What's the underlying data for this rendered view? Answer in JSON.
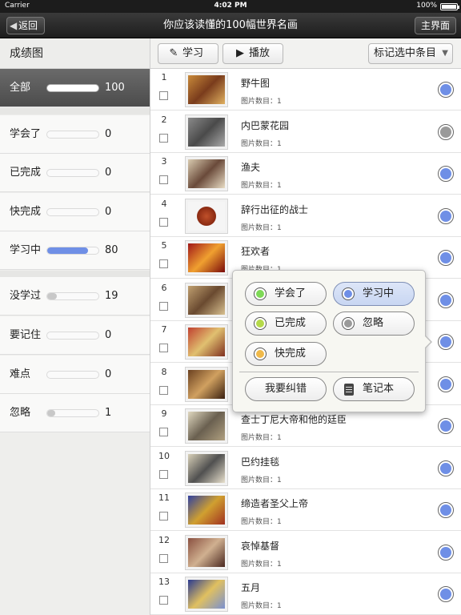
{
  "status_bar": {
    "carrier": "Carrier",
    "time": "4:02 PM",
    "battery": "100%"
  },
  "nav": {
    "back_label": "返回",
    "title": "你应该读懂的100幅世界名画",
    "home_label": "主界面"
  },
  "sidebar": {
    "header": "成绩图",
    "categories": [
      {
        "label": "全部",
        "count": "100",
        "level": 1.0,
        "color": "#ffffff",
        "selected": true
      },
      {
        "label": "学会了",
        "count": "0",
        "level": 0,
        "color": "#7ed957"
      },
      {
        "label": "已完成",
        "count": "0",
        "level": 0,
        "color": "#b5d94a"
      },
      {
        "label": "快完成",
        "count": "0",
        "level": 0,
        "color": "#f0b94a"
      },
      {
        "label": "学习中",
        "count": "80",
        "level": 0.8,
        "color": "#6f8fe6"
      },
      {
        "label": "没学过",
        "count": "19",
        "level": 0.19,
        "color": "#c8c8c8"
      },
      {
        "label": "要记住",
        "count": "0",
        "level": 0,
        "color": "#c8c8c8"
      },
      {
        "label": "难点",
        "count": "0",
        "level": 0,
        "color": "#c8c8c8"
      },
      {
        "label": "忽略",
        "count": "1",
        "level": 0.01,
        "color": "#c8c8c8"
      }
    ]
  },
  "toolbar": {
    "study_label": "学习",
    "study_icon": "pencil-icon",
    "play_label": "播放",
    "play_icon": "play-icon",
    "mark_label": "标记选中条目"
  },
  "list": {
    "items": [
      {
        "num": "1",
        "title": "野牛图",
        "meta": "图片数目：1",
        "status_color": "#6f8fe6"
      },
      {
        "num": "2",
        "title": "内巴蒙花园",
        "meta": "图片数目：1",
        "status_color": "#9a9a9a"
      },
      {
        "num": "3",
        "title": "渔夫",
        "meta": "图片数目：1",
        "status_color": "#6f8fe6"
      },
      {
        "num": "4",
        "title": "辞行出征的战士",
        "meta": "图片数目：1",
        "status_color": "#6f8fe6"
      },
      {
        "num": "5",
        "title": "狂欢者",
        "meta": "图片数目：1",
        "status_color": "#6f8fe6"
      },
      {
        "num": "6",
        "title": "",
        "meta": "",
        "status_color": "#6f8fe6"
      },
      {
        "num": "7",
        "title": "",
        "meta": "",
        "status_color": "#6f8fe6"
      },
      {
        "num": "8",
        "title": "",
        "meta": "",
        "status_color": "#6f8fe6"
      },
      {
        "num": "9",
        "title": "查士丁尼大帝和他的廷臣",
        "meta": "图片数目：1",
        "status_color": "#6f8fe6"
      },
      {
        "num": "10",
        "title": "巴约挂毯",
        "meta": "图片数目：1",
        "status_color": "#6f8fe6"
      },
      {
        "num": "11",
        "title": "缔造者圣父上帝",
        "meta": "图片数目：1",
        "status_color": "#6f8fe6"
      },
      {
        "num": "12",
        "title": "哀悼基督",
        "meta": "图片数目：1",
        "status_color": "#6f8fe6"
      },
      {
        "num": "13",
        "title": "五月",
        "meta": "图片数目：1",
        "status_color": "#6f8fe6"
      }
    ]
  },
  "popover": {
    "learned": {
      "label": "学会了",
      "color": "#7ed957"
    },
    "learning": {
      "label": "学习中",
      "color": "#6f8fe6"
    },
    "finished": {
      "label": "已完成",
      "color": "#b5d94a"
    },
    "ignore": {
      "label": "忽略",
      "color": "#9a9a9a"
    },
    "almost": {
      "label": "快完成",
      "color": "#f0b94a"
    },
    "report_label": "我要纠错",
    "notes_label": "笔记本",
    "notes_icon": "notebook-icon"
  }
}
